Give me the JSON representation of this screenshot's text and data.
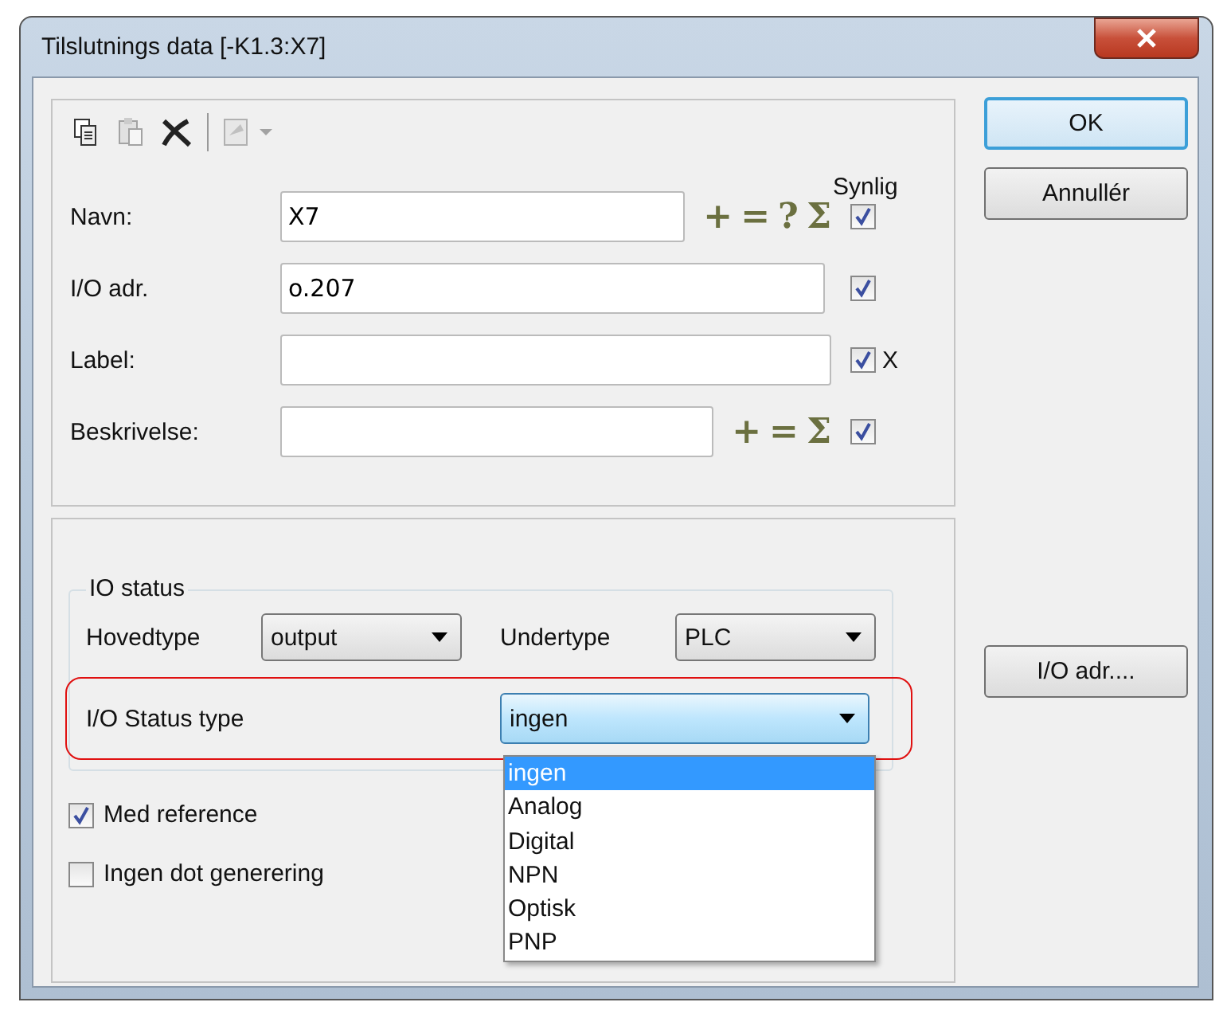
{
  "window": {
    "title": "Tilslutnings data [-K1.3:X7]"
  },
  "toolbar": [
    {
      "kind": "copy",
      "disabled": false
    },
    {
      "kind": "paste",
      "disabled": true
    },
    {
      "kind": "delete",
      "disabled": false
    },
    {
      "kind": "separator"
    },
    {
      "kind": "wizard",
      "disabled": true
    }
  ],
  "visible_header": "Synlig",
  "fields": [
    {
      "label": "Navn:",
      "value": "X7",
      "actions": [
        "+",
        "=",
        "?",
        "Σ"
      ],
      "visible": true
    },
    {
      "label": "I/O adr.",
      "value": "o.207",
      "visible": true
    },
    {
      "label": "Label:",
      "visible": true,
      "suffix": "X"
    },
    {
      "label": "Beskrivelse:",
      "actions": [
        "+",
        "=",
        "Σ"
      ],
      "visible": true
    }
  ],
  "io_status": {
    "title": "IO status",
    "hovedtype": {
      "label": "Hovedtype",
      "value": "output"
    },
    "undertype": {
      "label": "Undertype",
      "value": "PLC"
    },
    "status_type": {
      "label": "I/O Status type",
      "value": "ingen",
      "options": [
        {
          "label": "ingen",
          "selected": true
        },
        {
          "label": "Analog",
          "selected": false
        },
        {
          "label": "Digital",
          "selected": false
        },
        {
          "label": "NPN",
          "selected": false
        },
        {
          "label": "Optisk",
          "selected": false
        },
        {
          "label": "PNP",
          "selected": false
        }
      ]
    }
  },
  "checkboxes": [
    {
      "label": "Med reference",
      "checked": true
    },
    {
      "label": "Ingen dot generering",
      "checked": false
    }
  ],
  "buttons": [
    {
      "label": "OK",
      "default": true
    },
    {
      "label": "Annullér",
      "default": false
    }
  ],
  "side_button": {
    "label": "I/O adr...."
  }
}
